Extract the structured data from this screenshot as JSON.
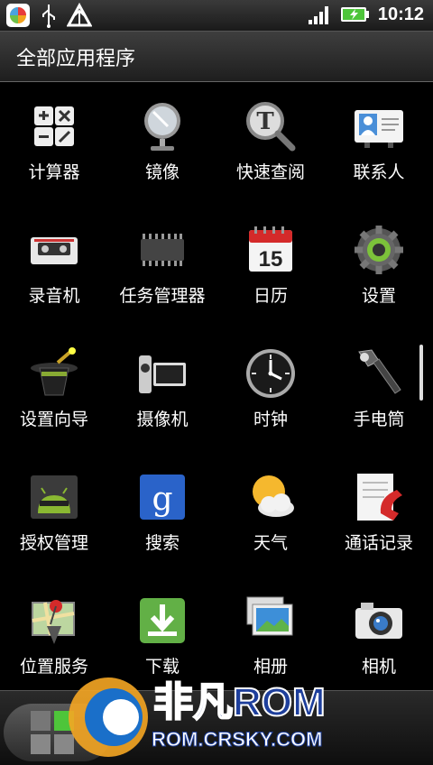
{
  "status_bar": {
    "time": "10:12",
    "icons": [
      "app-store-icon",
      "usb-icon",
      "upload-icon",
      "signal-icon",
      "battery-charging-icon"
    ]
  },
  "header": {
    "title": "全部应用程序"
  },
  "apps": [
    {
      "label": "计算器",
      "icon": "calculator-icon"
    },
    {
      "label": "镜像",
      "icon": "mirror-icon"
    },
    {
      "label": "快速查阅",
      "icon": "quick-lookup-icon"
    },
    {
      "label": "联系人",
      "icon": "contacts-icon"
    },
    {
      "label": "录音机",
      "icon": "voice-recorder-icon"
    },
    {
      "label": "任务管理器",
      "icon": "task-manager-icon"
    },
    {
      "label": "日历",
      "icon": "calendar-icon"
    },
    {
      "label": "设置",
      "icon": "settings-icon"
    },
    {
      "label": "设置向导",
      "icon": "setup-wizard-icon"
    },
    {
      "label": "摄像机",
      "icon": "camcorder-icon"
    },
    {
      "label": "时钟",
      "icon": "clock-icon"
    },
    {
      "label": "手电筒",
      "icon": "flashlight-icon"
    },
    {
      "label": "授权管理",
      "icon": "superuser-icon"
    },
    {
      "label": "搜索",
      "icon": "search-icon"
    },
    {
      "label": "天气",
      "icon": "weather-icon"
    },
    {
      "label": "通话记录",
      "icon": "call-log-icon"
    },
    {
      "label": "位置服务",
      "icon": "location-icon"
    },
    {
      "label": "下载",
      "icon": "download-icon"
    },
    {
      "label": "相册",
      "icon": "gallery-icon"
    },
    {
      "label": "相机",
      "icon": "camera-icon"
    }
  ],
  "calendar_day": "15",
  "watermark": {
    "brand": "非凡ROM",
    "url": "ROM.CRSKY.COM"
  }
}
